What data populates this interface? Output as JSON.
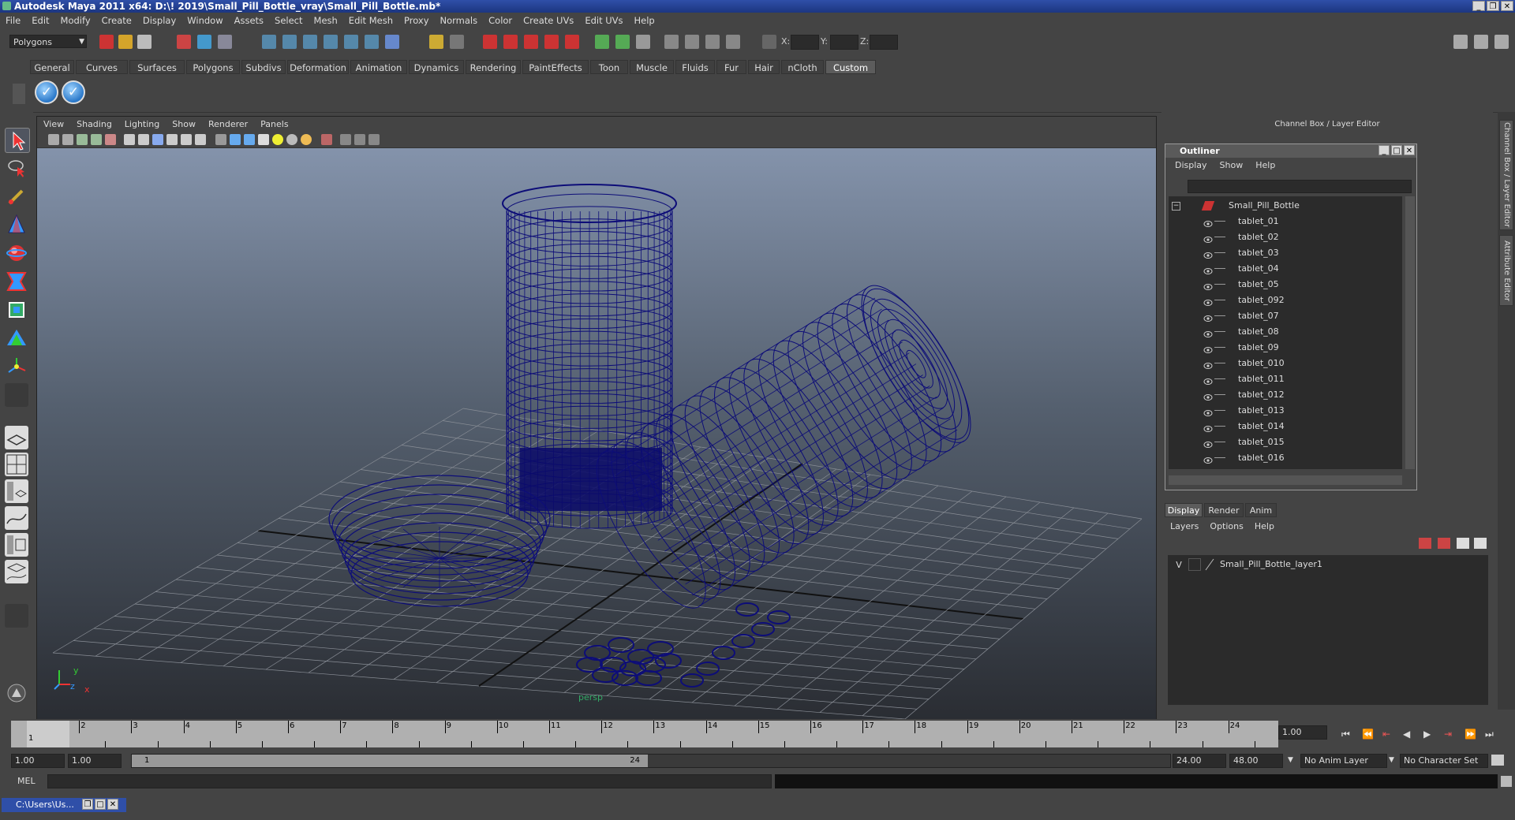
{
  "title": "Autodesk Maya 2011 x64: D:\\! 2019\\Small_Pill_Bottle_vray\\Small_Pill_Bottle.mb*",
  "menubar": [
    "File",
    "Edit",
    "Modify",
    "Create",
    "Display",
    "Window",
    "Assets",
    "Select",
    "Mesh",
    "Edit Mesh",
    "Proxy",
    "Normals",
    "Color",
    "Create UVs",
    "Edit UVs",
    "Help"
  ],
  "statusline": {
    "mode": "Polygons",
    "x_label": "X:",
    "y_label": "Y:",
    "z_label": "Z:"
  },
  "shelf_tabs": [
    "General",
    "Curves",
    "Surfaces",
    "Polygons",
    "Subdivs",
    "Deformation",
    "Animation",
    "Dynamics",
    "Rendering",
    "PaintEffects",
    "Toon",
    "Muscle",
    "Fluids",
    "Fur",
    "Hair",
    "nCloth",
    "Custom"
  ],
  "active_shelf_tab": "Custom",
  "viewport": {
    "menu": [
      "View",
      "Shading",
      "Lighting",
      "Show",
      "Renderer",
      "Panels"
    ],
    "camera_label": "persp",
    "axis_y": "y",
    "axis_z": "z",
    "axis_x": "x"
  },
  "channel_box_title": "Channel Box / Layer Editor",
  "outliner": {
    "title": "Outliner",
    "menu": [
      "Display",
      "Show",
      "Help"
    ],
    "root": "Small_Pill_Bottle",
    "items": [
      "tablet_01",
      "tablet_02",
      "tablet_03",
      "tablet_04",
      "tablet_05",
      "tablet_092",
      "tablet_07",
      "tablet_08",
      "tablet_09",
      "tablet_010",
      "tablet_011",
      "tablet_012",
      "tablet_013",
      "tablet_014",
      "tablet_015",
      "tablet_016"
    ]
  },
  "layer_editor": {
    "tabs": [
      "Display",
      "Render",
      "Anim"
    ],
    "menu": [
      "Layers",
      "Options",
      "Help"
    ],
    "layer_visibility": "V",
    "layer_name": "Small_Pill_Bottle_layer1"
  },
  "side_tabs": [
    "Channel Box / Layer Editor",
    "Attribute Editor"
  ],
  "timeline": {
    "ticks": [
      "1",
      "2",
      "3",
      "4",
      "5",
      "6",
      "7",
      "8",
      "9",
      "10",
      "11",
      "12",
      "13",
      "14",
      "15",
      "16",
      "17",
      "18",
      "19",
      "20",
      "21",
      "22",
      "23",
      "24"
    ],
    "current_frame_marker": "1",
    "current_time": "1.00"
  },
  "range": {
    "start": "1.00",
    "inner_start": "1.00",
    "thumb_start": "1",
    "thumb_end": "24",
    "end": "24.00",
    "outer_end": "48.00",
    "anim_layer": "No Anim Layer",
    "character_set": "No Character Set"
  },
  "command": {
    "label": "MEL"
  },
  "taskbar": {
    "minimized_window": "C:\\Users\\Us..."
  }
}
